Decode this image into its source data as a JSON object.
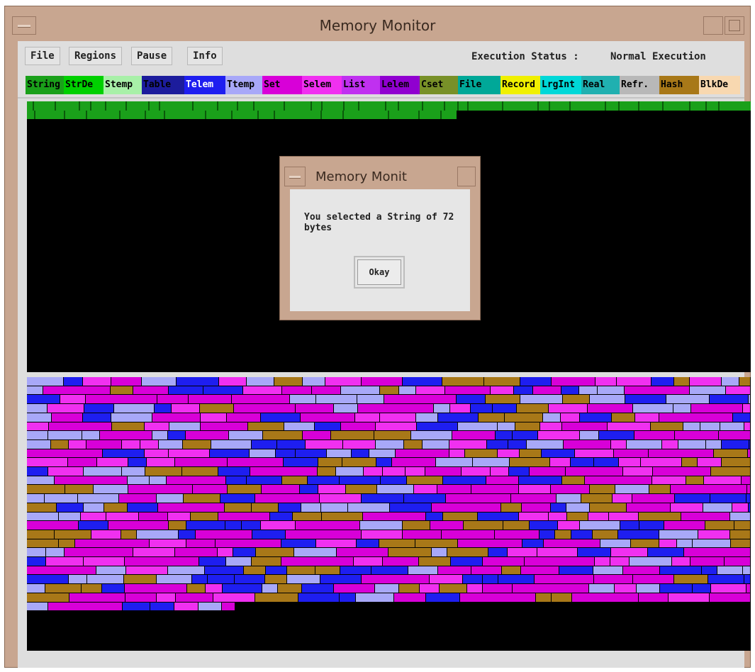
{
  "window": {
    "title": "Memory Monitor"
  },
  "menu": {
    "file": "File",
    "regions": "Regions",
    "pause": "Pause",
    "info": "Info"
  },
  "status": {
    "label": "Execution Status :",
    "value": "Normal Execution"
  },
  "legend": [
    {
      "label": "String",
      "bg": "#1aa01a",
      "fg": "#000000"
    },
    {
      "label": "StrDe",
      "bg": "#00d000",
      "fg": "#000000"
    },
    {
      "label": "Stemp",
      "bg": "#a8f0a8",
      "fg": "#000000"
    },
    {
      "label": "Table",
      "bg": "#1c1c9c",
      "fg": "#000000"
    },
    {
      "label": "Telem",
      "bg": "#1e1ef0",
      "fg": "#ffffff"
    },
    {
      "label": "Ttemp",
      "bg": "#a8a8f8",
      "fg": "#000000"
    },
    {
      "label": "Set",
      "bg": "#d800d8",
      "fg": "#000000"
    },
    {
      "label": "Selem",
      "bg": "#f030f0",
      "fg": "#000000"
    },
    {
      "label": "List",
      "bg": "#c030f0",
      "fg": "#000000"
    },
    {
      "label": "Lelem",
      "bg": "#9000d0",
      "fg": "#000000"
    },
    {
      "label": "Cset",
      "bg": "#789028",
      "fg": "#000000"
    },
    {
      "label": "File",
      "bg": "#00a898",
      "fg": "#000000"
    },
    {
      "label": "Record",
      "bg": "#f0f000",
      "fg": "#000000"
    },
    {
      "label": "LrgInt",
      "bg": "#00d8d8",
      "fg": "#000000"
    },
    {
      "label": "Real",
      "bg": "#20b0b0",
      "fg": "#000000"
    },
    {
      "label": "Refr.",
      "bg": "#b8b8b8",
      "fg": "#000000"
    },
    {
      "label": "Hash",
      "bg": "#a87818",
      "fg": "#000000"
    },
    {
      "label": "BlkDe",
      "bg": "#f8d8b0",
      "fg": "#000000"
    }
  ],
  "dialog": {
    "title": "Memory Monit",
    "message": "You selected a String of 72 bytes",
    "button": "Okay"
  },
  "colors": {
    "string_region": "#1aa01a",
    "block_palette": [
      "#d800d8",
      "#f030f0",
      "#a8a8f8",
      "#1e1ef0",
      "#a87818"
    ]
  }
}
